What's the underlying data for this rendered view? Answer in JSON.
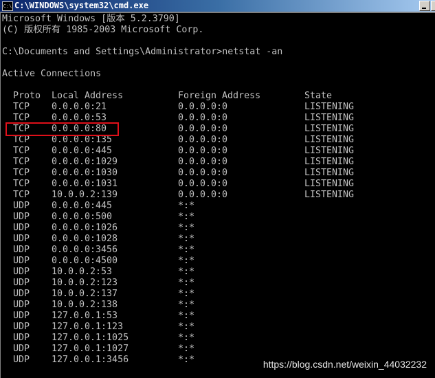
{
  "window": {
    "title": "C:\\WINDOWS\\system32\\cmd.exe",
    "icon": "cmd-icon"
  },
  "console": {
    "banner1": "Microsoft Windows [版本 5.2.3790]",
    "banner2": "(C) 版权所有 1985-2003 Microsoft Corp.",
    "prompt": "C:\\Documents and Settings\\Administrator>netstat -an",
    "section": "Active Connections",
    "headers": {
      "proto": "Proto",
      "local": "Local Address",
      "foreign": "Foreign Address",
      "state": "State"
    },
    "rows": [
      {
        "proto": "TCP",
        "local": "0.0.0.0:21",
        "foreign": "0.0.0.0:0",
        "state": "LISTENING"
      },
      {
        "proto": "TCP",
        "local": "0.0.0.0:53",
        "foreign": "0.0.0.0:0",
        "state": "LISTENING"
      },
      {
        "proto": "TCP",
        "local": "0.0.0.0:80",
        "foreign": "0.0.0.0:0",
        "state": "LISTENING",
        "highlighted": true
      },
      {
        "proto": "TCP",
        "local": "0.0.0.0:135",
        "foreign": "0.0.0.0:0",
        "state": "LISTENING"
      },
      {
        "proto": "TCP",
        "local": "0.0.0.0:445",
        "foreign": "0.0.0.0:0",
        "state": "LISTENING"
      },
      {
        "proto": "TCP",
        "local": "0.0.0.0:1029",
        "foreign": "0.0.0.0:0",
        "state": "LISTENING"
      },
      {
        "proto": "TCP",
        "local": "0.0.0.0:1030",
        "foreign": "0.0.0.0:0",
        "state": "LISTENING"
      },
      {
        "proto": "TCP",
        "local": "0.0.0.0:1031",
        "foreign": "0.0.0.0:0",
        "state": "LISTENING"
      },
      {
        "proto": "TCP",
        "local": "10.0.0.2:139",
        "foreign": "0.0.0.0:0",
        "state": "LISTENING"
      },
      {
        "proto": "UDP",
        "local": "0.0.0.0:445",
        "foreign": "*:*",
        "state": ""
      },
      {
        "proto": "UDP",
        "local": "0.0.0.0:500",
        "foreign": "*:*",
        "state": ""
      },
      {
        "proto": "UDP",
        "local": "0.0.0.0:1026",
        "foreign": "*:*",
        "state": ""
      },
      {
        "proto": "UDP",
        "local": "0.0.0.0:1028",
        "foreign": "*:*",
        "state": ""
      },
      {
        "proto": "UDP",
        "local": "0.0.0.0:3456",
        "foreign": "*:*",
        "state": ""
      },
      {
        "proto": "UDP",
        "local": "0.0.0.0:4500",
        "foreign": "*:*",
        "state": ""
      },
      {
        "proto": "UDP",
        "local": "10.0.0.2:53",
        "foreign": "*:*",
        "state": ""
      },
      {
        "proto": "UDP",
        "local": "10.0.0.2:123",
        "foreign": "*:*",
        "state": ""
      },
      {
        "proto": "UDP",
        "local": "10.0.0.2:137",
        "foreign": "*:*",
        "state": ""
      },
      {
        "proto": "UDP",
        "local": "10.0.0.2:138",
        "foreign": "*:*",
        "state": ""
      },
      {
        "proto": "UDP",
        "local": "127.0.0.1:53",
        "foreign": "*:*",
        "state": ""
      },
      {
        "proto": "UDP",
        "local": "127.0.0.1:123",
        "foreign": "*:*",
        "state": ""
      },
      {
        "proto": "UDP",
        "local": "127.0.0.1:1025",
        "foreign": "*:*",
        "state": ""
      },
      {
        "proto": "UDP",
        "local": "127.0.0.1:1027",
        "foreign": "*:*",
        "state": ""
      },
      {
        "proto": "UDP",
        "local": "127.0.0.1:3456",
        "foreign": "*:*",
        "state": ""
      }
    ],
    "highlight_color": "#e0101a"
  },
  "watermark": "https://blog.csdn.net/weixin_44032232"
}
